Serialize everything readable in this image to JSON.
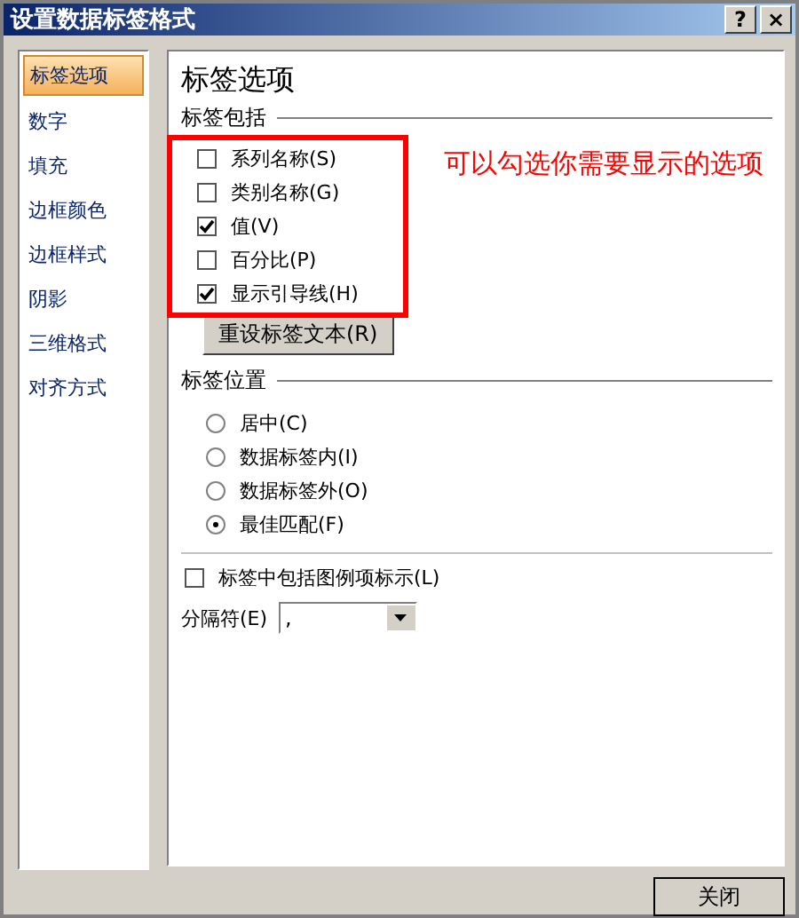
{
  "window": {
    "title": "设置数据标签格式",
    "buttons": [
      "?",
      "×"
    ]
  },
  "sidebar": {
    "items": [
      {
        "label": "标签选项",
        "selected": true
      },
      {
        "label": "数字",
        "selected": false
      },
      {
        "label": "填充",
        "selected": false
      },
      {
        "label": "边框颜色",
        "selected": false
      },
      {
        "label": "边框样式",
        "selected": false
      },
      {
        "label": "阴影",
        "selected": false
      },
      {
        "label": "三维格式",
        "selected": false
      },
      {
        "label": "对齐方式",
        "selected": false
      }
    ]
  },
  "panel": {
    "title": "标签选项",
    "include": {
      "heading": "标签包括",
      "options": [
        {
          "label": "系列名称(S)",
          "checked": false
        },
        {
          "label": "类别名称(G)",
          "checked": false
        },
        {
          "label": "值(V)",
          "checked": true
        },
        {
          "label": "百分比(P)",
          "checked": false
        },
        {
          "label": "显示引导线(H)",
          "checked": true
        }
      ],
      "reset_button": "重设标签文本(R)"
    },
    "position": {
      "heading": "标签位置",
      "options": [
        {
          "label": "居中(C)",
          "selected": false
        },
        {
          "label": "数据标签内(I)",
          "selected": false
        },
        {
          "label": "数据标签外(O)",
          "selected": false
        },
        {
          "label": "最佳匹配(F)",
          "selected": true
        }
      ]
    },
    "legend_key": {
      "label": "标签中包括图例项标示(L)",
      "checked": false
    },
    "separator": {
      "label": "分隔符(E)",
      "value": ","
    }
  },
  "annotation": {
    "text": "可以勾选你需要显示的选项"
  },
  "close_button": "关闭"
}
